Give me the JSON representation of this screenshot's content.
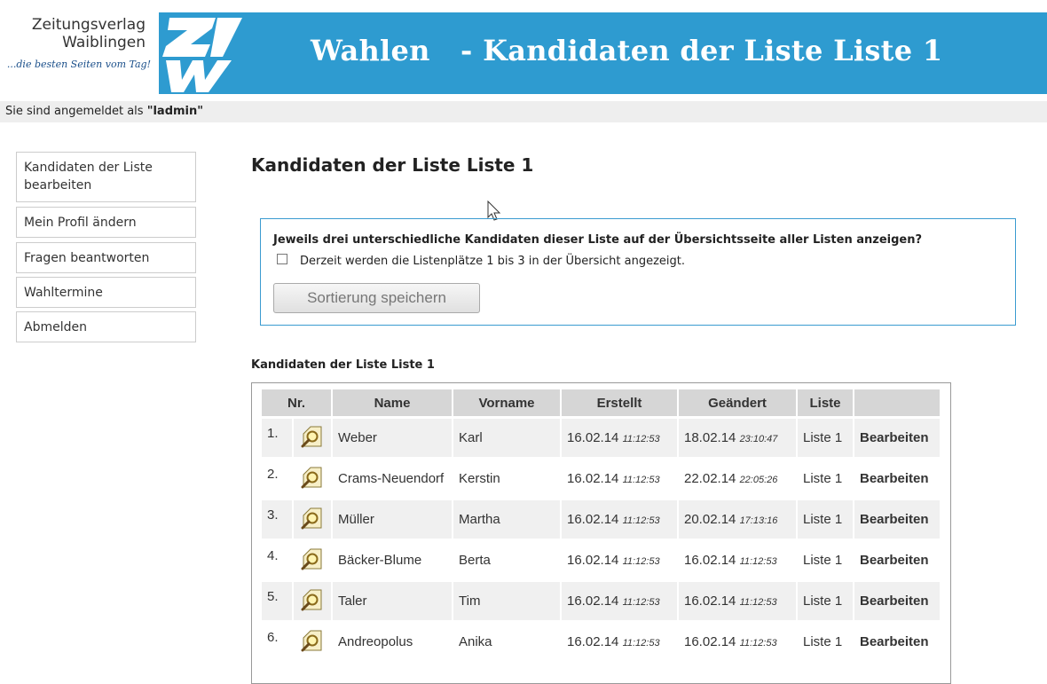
{
  "header": {
    "logo_line1": "Zeitungsverlag",
    "logo_line2": "Waiblingen",
    "logo_slogan": "...die besten Seiten vom Tag!",
    "title": "Wahlen   - Kandidaten der Liste Liste 1",
    "colors": {
      "header_bg": "#2e9bd0",
      "accent_border": "#3a9bd0"
    }
  },
  "login": {
    "prefix": "Sie sind angemeldet als ",
    "user": "\"ladmin\""
  },
  "sidebar": {
    "items": [
      {
        "label": "Kandidaten der Liste bearbeiten"
      },
      {
        "label": "Mein Profil ändern"
      },
      {
        "label": "Fragen beantworten"
      },
      {
        "label": "Wahltermine"
      },
      {
        "label": "Abmelden"
      }
    ]
  },
  "main": {
    "title": "Kandidaten der Liste Liste 1",
    "sort": {
      "question": "Jeweils drei unterschiedliche Kandidaten dieser Liste auf der Übersichtsseite aller Listen anzeigen?",
      "checkbox_label": "Derzeit werden die Listenplätze 1 bis 3 in der Übersicht angezeigt.",
      "checkbox_checked": false,
      "button": "Sortierung speichern"
    },
    "table_caption": "Kandidaten der Liste Liste 1",
    "columns": [
      "Nr.",
      "Name",
      "Vorname",
      "Erstellt",
      "Geändert",
      "Liste",
      ""
    ],
    "rows": [
      {
        "nr": "1.",
        "name": "Weber",
        "vorname": "Karl",
        "erstellt_date": "16.02.14",
        "erstellt_time": "11:12:53",
        "geaendert_date": "18.02.14",
        "geaendert_time": "23:10:47",
        "liste": "Liste 1",
        "action": "Bearbeiten"
      },
      {
        "nr": "2.",
        "name": "Crams-Neuendorf",
        "vorname": "Kerstin",
        "erstellt_date": "16.02.14",
        "erstellt_time": "11:12:53",
        "geaendert_date": "22.02.14",
        "geaendert_time": "22:05:26",
        "liste": "Liste 1",
        "action": "Bearbeiten"
      },
      {
        "nr": "3.",
        "name": "Müller",
        "vorname": "Martha",
        "erstellt_date": "16.02.14",
        "erstellt_time": "11:12:53",
        "geaendert_date": "20.02.14",
        "geaendert_time": "17:13:16",
        "liste": "Liste 1",
        "action": "Bearbeiten"
      },
      {
        "nr": "4.",
        "name": "Bäcker-Blume",
        "vorname": "Berta",
        "erstellt_date": "16.02.14",
        "erstellt_time": "11:12:53",
        "geaendert_date": "16.02.14",
        "geaendert_time": "11:12:53",
        "liste": "Liste 1",
        "action": "Bearbeiten"
      },
      {
        "nr": "5.",
        "name": "Taler",
        "vorname": "Tim",
        "erstellt_date": "16.02.14",
        "erstellt_time": "11:12:53",
        "geaendert_date": "16.02.14",
        "geaendert_time": "11:12:53",
        "liste": "Liste 1",
        "action": "Bearbeiten"
      },
      {
        "nr": "6.",
        "name": "Andreopolus",
        "vorname": "Anika",
        "erstellt_date": "16.02.14",
        "erstellt_time": "11:12:53",
        "geaendert_date": "16.02.14",
        "geaendert_time": "11:12:53",
        "liste": "Liste 1",
        "action": "Bearbeiten"
      }
    ]
  }
}
